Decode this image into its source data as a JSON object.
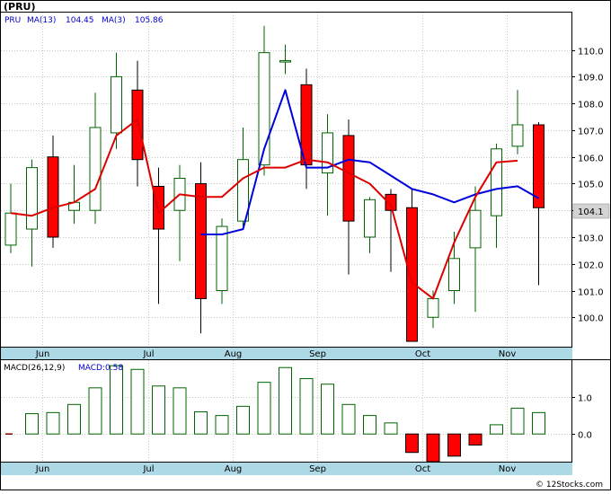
{
  "header": {
    "symbol": "(PRU)",
    "legend_symbol": "PRU",
    "ma13_label": "MA(13)",
    "ma13_value": "104.45",
    "ma3_label": "MA(3)",
    "ma3_value": "105.86",
    "last_price_tag": "104.1"
  },
  "macd_header": {
    "params": "MACD(26,12,9)",
    "value_label": "MACD:0.58"
  },
  "footer": {
    "credit": "© 12Stocks.com"
  },
  "colors": {
    "up_candle": "#006400",
    "down_candle": "#ff0000",
    "ma13_line": "#0000dd",
    "ma3_line": "#dd0000",
    "axis_band": "#add8e6",
    "grid": "#c8c8c8",
    "price_tag_bg": "#d3d3d3",
    "label_blue": "#0000cc"
  },
  "chart_data": [
    {
      "type": "candlestick",
      "title": "(PRU)",
      "x_tick_labels": [
        "Jun",
        "Jul",
        "Aug",
        "Sep",
        "Oct",
        "Nov"
      ],
      "x_tick_positions": [
        1.5,
        6.5,
        10.5,
        14.5,
        19.5,
        23.5
      ],
      "y_tick_labels": [
        "100.0",
        "101.0",
        "102.0",
        "103.0",
        "104.0",
        "105.0",
        "106.0",
        "107.0",
        "108.0",
        "109.0",
        "110.0"
      ],
      "y_ticks": [
        100,
        101,
        102,
        103,
        104,
        105,
        106,
        107,
        108,
        109,
        110
      ],
      "ylim": [
        98.9,
        111.4
      ],
      "grid": true,
      "candles": [
        {
          "o": 102.7,
          "h": 105.0,
          "l": 102.4,
          "c": 103.9
        },
        {
          "o": 103.3,
          "h": 105.9,
          "l": 101.9,
          "c": 105.6
        },
        {
          "o": 106.0,
          "h": 106.8,
          "l": 102.6,
          "c": 103.0
        },
        {
          "o": 104.0,
          "h": 105.7,
          "l": 103.5,
          "c": 104.3
        },
        {
          "o": 104.0,
          "h": 108.4,
          "l": 103.5,
          "c": 107.1
        },
        {
          "o": 106.9,
          "h": 109.9,
          "l": 106.3,
          "c": 109.0
        },
        {
          "o": 108.5,
          "h": 109.6,
          "l": 104.9,
          "c": 105.9
        },
        {
          "o": 104.9,
          "h": 105.6,
          "l": 100.5,
          "c": 103.3
        },
        {
          "o": 104.0,
          "h": 105.7,
          "l": 102.1,
          "c": 105.2
        },
        {
          "o": 105.0,
          "h": 105.8,
          "l": 99.4,
          "c": 100.7
        },
        {
          "o": 101.0,
          "h": 103.7,
          "l": 100.5,
          "c": 103.4
        },
        {
          "o": 103.6,
          "h": 107.1,
          "l": 103.4,
          "c": 105.9
        },
        {
          "o": 105.7,
          "h": 110.9,
          "l": 105.3,
          "c": 109.9
        },
        {
          "o": 109.6,
          "h": 110.2,
          "l": 109.1,
          "c": 109.6
        },
        {
          "o": 108.7,
          "h": 109.3,
          "l": 104.8,
          "c": 105.7
        },
        {
          "o": 105.4,
          "h": 107.6,
          "l": 103.8,
          "c": 106.9
        },
        {
          "o": 106.8,
          "h": 107.4,
          "l": 101.6,
          "c": 103.6
        },
        {
          "o": 103.0,
          "h": 104.5,
          "l": 102.4,
          "c": 104.4
        },
        {
          "o": 104.6,
          "h": 104.8,
          "l": 101.7,
          "c": 104.0
        },
        {
          "o": 104.1,
          "h": 104.8,
          "l": 99.1,
          "c": 99.1
        },
        {
          "o": 100.0,
          "h": 101.0,
          "l": 99.6,
          "c": 100.7
        },
        {
          "o": 101.0,
          "h": 103.2,
          "l": 100.5,
          "c": 102.2
        },
        {
          "o": 102.6,
          "h": 104.9,
          "l": 100.2,
          "c": 104.0
        },
        {
          "o": 103.8,
          "h": 106.5,
          "l": 102.6,
          "c": 106.3
        },
        {
          "o": 106.4,
          "h": 108.5,
          "l": 106.1,
          "c": 107.2
        },
        {
          "o": 107.2,
          "h": 107.3,
          "l": 101.2,
          "c": 104.1
        }
      ],
      "series": [
        {
          "name": "MA(13)",
          "values": [
            null,
            null,
            null,
            null,
            null,
            null,
            null,
            null,
            null,
            103.1,
            103.1,
            103.3,
            106.3,
            108.5,
            105.6,
            105.6,
            105.9,
            105.8,
            105.3,
            104.8,
            104.6,
            104.3,
            104.6,
            104.8,
            104.9,
            104.45
          ]
        },
        {
          "name": "MA(3)",
          "values": [
            103.9,
            103.8,
            104.1,
            104.3,
            104.8,
            106.8,
            107.4,
            103.9,
            104.6,
            104.5,
            104.5,
            105.2,
            105.6,
            105.6,
            105.9,
            105.8,
            105.4,
            105.0,
            104.2,
            101.3,
            100.7,
            102.8,
            104.5,
            105.8,
            105.86,
            null
          ]
        }
      ]
    },
    {
      "type": "bar",
      "title": "MACD(26,12,9)",
      "x_tick_labels": [
        "Jun",
        "Jul",
        "Aug",
        "Sep",
        "Oct",
        "Nov"
      ],
      "y_tick_labels": [
        "0.0",
        "1.0"
      ],
      "y_ticks": [
        0,
        1
      ],
      "ylim": [
        -0.75,
        2.0
      ],
      "grid": true,
      "values": [
        0.0,
        0.55,
        0.58,
        0.8,
        1.25,
        1.85,
        1.75,
        1.3,
        1.25,
        0.6,
        0.5,
        0.75,
        1.4,
        1.8,
        1.5,
        1.35,
        0.8,
        0.5,
        0.3,
        -0.5,
        -0.75,
        -0.6,
        -0.3,
        0.25,
        0.7,
        0.58
      ]
    }
  ]
}
